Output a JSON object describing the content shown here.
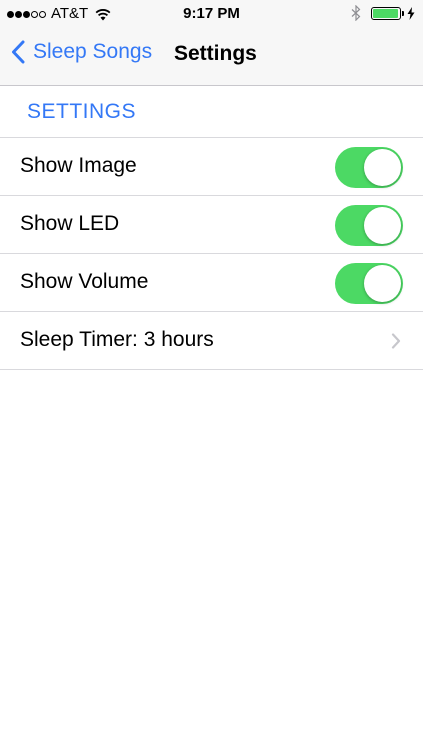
{
  "status_bar": {
    "signal_bars_filled": 3,
    "signal_bars_total": 5,
    "carrier": "AT&T",
    "time": "9:17 PM",
    "battery_level": 0.95,
    "icons": [
      "wifi-icon",
      "bluetooth-icon",
      "battery-icon",
      "charging-bolt-icon"
    ]
  },
  "nav": {
    "back_label": "Sleep Songs",
    "title": "Settings"
  },
  "section": {
    "header": "SETTINGS"
  },
  "settings": {
    "items": [
      {
        "label": "Show Image",
        "type": "toggle",
        "on": true
      },
      {
        "label": "Show LED",
        "type": "toggle",
        "on": true
      },
      {
        "label": "Show Volume",
        "type": "toggle",
        "on": true
      },
      {
        "label": "Sleep Timer: 3 hours",
        "type": "disclosure"
      }
    ]
  },
  "colors": {
    "accent": "#3478f6",
    "toggle_on": "#4cd964",
    "battery": "#4cd964",
    "disclosure": "#c7c7cc",
    "separator": "#d9d9dd",
    "nav_background": "#f7f7f7"
  }
}
